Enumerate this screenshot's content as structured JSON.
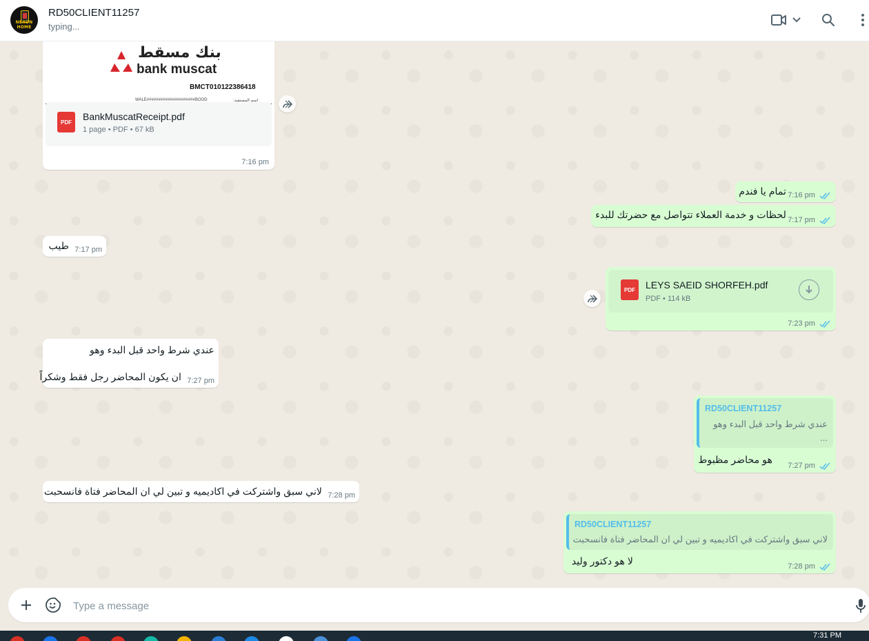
{
  "header": {
    "contact_name": "RD50CLIENT11257",
    "status": "typing...",
    "avatar_text": "NEXON HOME",
    "icons": [
      "video-call-icon",
      "chevron-down-icon",
      "search-icon",
      "menu-dots-icon"
    ]
  },
  "messages": {
    "receipt": {
      "bank_arabic": "بنك مسقط",
      "bank_english": "bank muscat",
      "reference": "BMCT010122386418",
      "beneficiary_label": "اسم المستفيد:",
      "beneficiary_value": "WALE#####################BOOD",
      "file_name": "BankMuscatReceipt.pdf",
      "file_info": "1 page • PDF • 67 kB",
      "pdf_label": "PDF",
      "time": "7:16 pm"
    },
    "out1": {
      "text": "تمام يا فندم",
      "time": "7:16 pm"
    },
    "out2": {
      "text": "لحظات و خدمة العملاء تتواصل مع حضرتك للبدء",
      "time": "7:17 pm"
    },
    "in1": {
      "text": "طيب",
      "time": "7:17 pm"
    },
    "out_doc": {
      "file_name": "LEYS SAEID SHORFEH.pdf",
      "file_info": "PDF • 114 kB",
      "pdf_label": "PDF",
      "time": "7:23 pm"
    },
    "in2": {
      "line1": "عندي شرط واحد قبل البدء وهو",
      "line2": "ان يكون المحاضر رجل فقط وشكراً",
      "time": "7:27 pm"
    },
    "out3": {
      "quote_author": "RD50CLIENT11257",
      "quote_line1": "عندي شرط واحد قبل البدء وهو",
      "quote_line2": "...",
      "text": "هو محاضر مظبوط",
      "time": "7:27 pm"
    },
    "in3": {
      "text": "لاني سبق واشتركت في اكاديميه و تبين لي ان المحاضر فتاة فانسحبت",
      "time": "7:28 pm"
    },
    "out4": {
      "quote_author": "RD50CLIENT11257",
      "quote_text": "لاني سبق واشتركت في اكاديميه و تبين لي ان المحاضر فتاة فانسحبت",
      "text": "لا هو دكتور وليد",
      "time": "7:28 pm"
    }
  },
  "composer": {
    "placeholder": "Type a message"
  },
  "taskbar": {
    "time": "7:31 PM"
  },
  "colors": {
    "incoming": "#ffffff",
    "outgoing": "#d9fdd3",
    "tick_read": "#53bdeb",
    "quote_accent": "#53bdeb"
  }
}
